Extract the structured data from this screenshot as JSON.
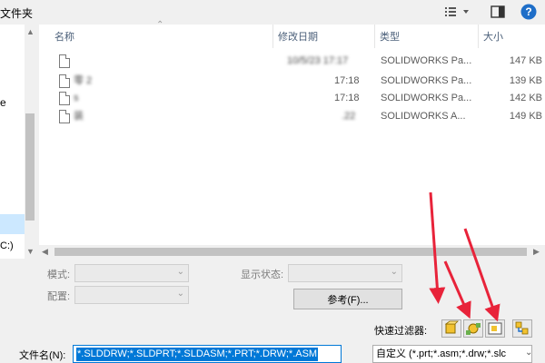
{
  "toolbar": {
    "new_folder": "文件夹",
    "view_icon": "view-list-icon",
    "help_icon": "help-icon"
  },
  "nav": {
    "items": [
      "e",
      "C:)"
    ]
  },
  "columns": {
    "name": "名称",
    "date": "修改日期",
    "type": "类型",
    "size": "大小"
  },
  "files": [
    {
      "name": "",
      "date": "10/5/23 17:17",
      "type": "SOLIDWORKS Pa...",
      "size": "147 KB"
    },
    {
      "name": "零 2",
      "date": "17:18",
      "type": "SOLIDWORKS Pa...",
      "size": "139 KB"
    },
    {
      "name": "s",
      "date": "17:18",
      "type": "SOLIDWORKS Pa...",
      "size": "142 KB"
    },
    {
      "name": "装",
      "date": ".22",
      "type": "SOLIDWORKS A...",
      "size": "149 KB"
    }
  ],
  "options": {
    "mode_label": "模式:",
    "config_label": "配置:",
    "display_state_label": "显示状态:",
    "reference_button": "参考(F)...",
    "quick_filter_label": "快速过滤器:",
    "filename_label": "文件名(N):",
    "filename_value": "*.SLDDRW;*.SLDPRT;*.SLDASM;*.PRT;*.DRW;*.ASM",
    "filter_value": "自定义 (*.prt;*.asm;*.drw;*.slc"
  },
  "colors": {
    "accent": "#0078d7",
    "annotation_arrow": "#e8233a",
    "help": "#1e6ec8"
  }
}
